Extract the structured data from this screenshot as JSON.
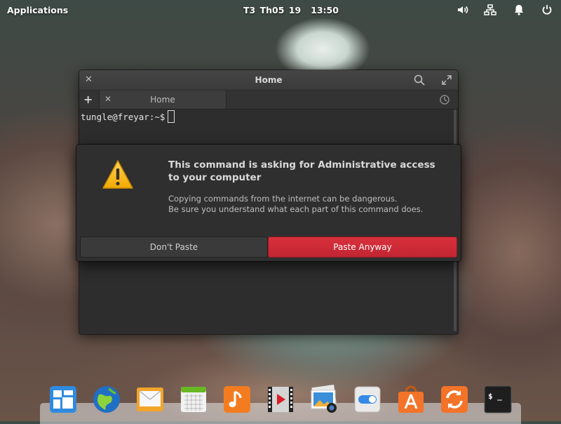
{
  "panel": {
    "applications": "Applications",
    "date": "T3 Th05 19",
    "time": "13:50",
    "indicators": [
      "volume-icon",
      "network-icon",
      "notifications-icon",
      "power-icon"
    ]
  },
  "window": {
    "title": "Home",
    "tab_label": "Home",
    "prompt": "tungle@freyar:~$"
  },
  "dialog": {
    "heading": "This command is asking for Administrative access to your computer",
    "body_line1": "Copying commands from the internet can be dangerous.",
    "body_line2": "Be sure you understand what each part of this command does.",
    "cancel_label": "Don't Paste",
    "confirm_label": "Paste Anyway",
    "accent_color": "#c8303c"
  },
  "dock": {
    "apps": [
      "multitasking-view-icon",
      "web-browser-icon",
      "mail-icon",
      "calendar-icon",
      "music-icon",
      "videos-icon",
      "photos-icon",
      "settings-icon",
      "appcenter-icon",
      "updates-icon",
      "terminal-icon"
    ],
    "terminal_glyph": "$ _"
  }
}
